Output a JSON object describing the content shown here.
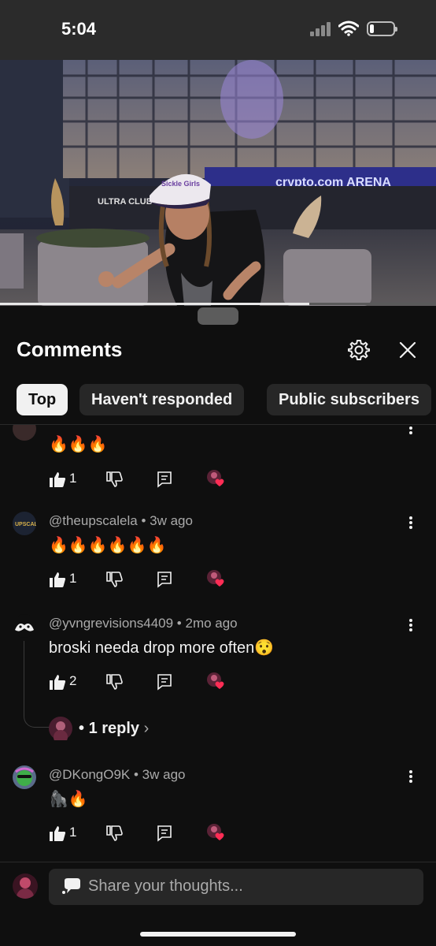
{
  "status_bar": {
    "time": "5:04",
    "battery_level": 0.15
  },
  "video": {
    "venue_sign": "crypto.com ARENA",
    "hat_text": "Sickle Girls",
    "store_sign": "ULTRA CLUB",
    "progress": 0.71
  },
  "comments_panel": {
    "title": "Comments",
    "settings_icon": "gear-icon",
    "close_icon": "close-icon",
    "filters": [
      "Top",
      "Haven't responded",
      "Public subscribers"
    ],
    "active_filter": "Top",
    "comments": [
      {
        "author": "",
        "age": "",
        "text": "🔥🔥🔥",
        "likes": "1"
      },
      {
        "author": "@theupscalela",
        "age": "3w ago",
        "text": "🔥🔥🔥🔥🔥🔥",
        "likes": "1"
      },
      {
        "author": "@yvngrevisions4409",
        "age": "2mo ago",
        "text": "broski needa drop more often😯",
        "likes": "2",
        "replies": "1 reply"
      },
      {
        "author": "@DKongO9K",
        "age": "3w ago",
        "text": "🦍🔥",
        "likes": "1"
      }
    ],
    "composer_placeholder": "Share your thoughts..."
  },
  "colors": {
    "background": "#0f0f0f",
    "chip_bg": "#272727",
    "active_chip_bg": "#f1f1f1",
    "heart": "#ff2d55"
  }
}
